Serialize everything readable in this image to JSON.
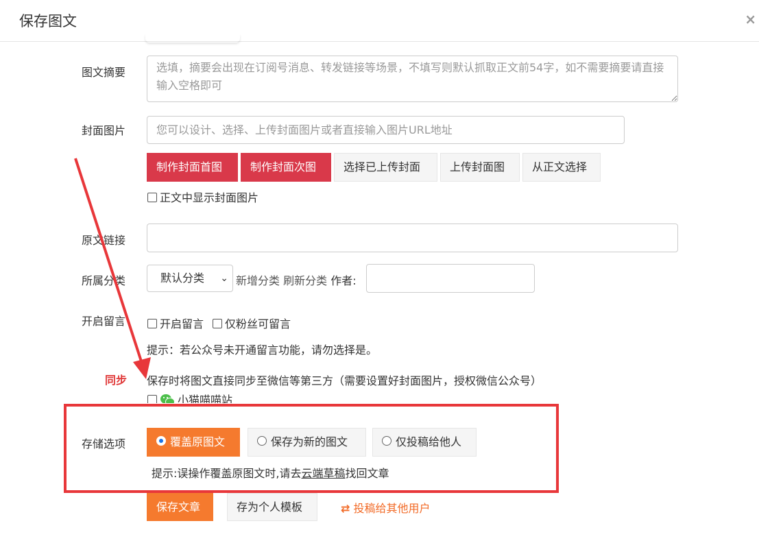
{
  "header": {
    "title": "保存图文",
    "close": "×"
  },
  "summary": {
    "label": "图文摘要",
    "placeholder": "选填，摘要会出现在订阅号消息、转发链接等场景，不填写则默认抓取正文前54字，如不需要摘要请直接输入空格即可"
  },
  "cover": {
    "label": "封面图片",
    "placeholder": "您可以设计、选择、上传封面图片或者直接输入图片URL地址",
    "buttons": [
      "制作封面首图",
      "制作封面次图",
      "选择已上传封面",
      "上传封面图",
      "从正文选择"
    ],
    "show_in_body": "正文中显示封面图片"
  },
  "source_link": {
    "label": "原文链接",
    "value": ""
  },
  "category": {
    "label": "所属分类",
    "selected": "默认分类",
    "add": "新增分类",
    "refresh": "刷新分类",
    "author_label": "作者:",
    "author_value": ""
  },
  "comments": {
    "label": "开启留言",
    "open": "开启留言",
    "fans_only": "仅粉丝可留言",
    "hint": "提示：若公众号未开通留言功能，请勿选择是。"
  },
  "sync": {
    "label": "同步",
    "text": "保存时将图文直接同步至微信等第三方（需要设置好封面图片，授权微信公众号）",
    "account": "小猫喵喵站"
  },
  "storage": {
    "label": "存储选项",
    "options": [
      "覆盖原图文",
      "保存为新的图文",
      "仅投稿给他人"
    ],
    "hint_prefix": "提示:误操作覆盖原图文时,请去",
    "hint_link": "云端草稿",
    "hint_suffix": "找回文章"
  },
  "actions": {
    "save": "保存文章",
    "save_template": "存为个人模板",
    "submit_other": "投稿给其他用户"
  },
  "colors": {
    "red_button": "#d9394a",
    "orange_button": "#f57a2e",
    "annotation_red": "#e8373a",
    "link_orange": "#f26a26"
  }
}
